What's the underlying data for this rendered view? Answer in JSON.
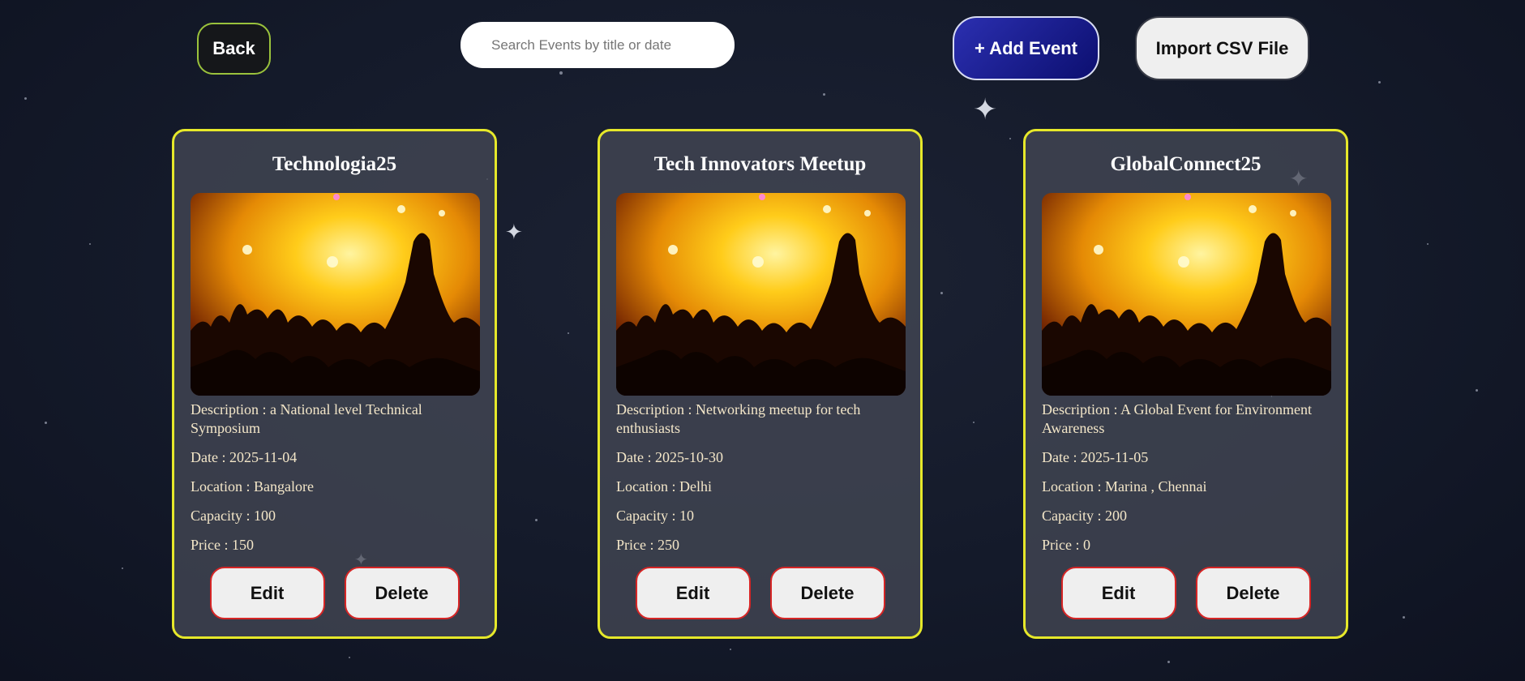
{
  "toolbar": {
    "back_label": "Back",
    "search_placeholder": "Search Events by title or date",
    "search_value": "",
    "add_label": "+ Add Event",
    "import_label": "Import CSV File"
  },
  "field_labels": {
    "description": "Description : ",
    "date": "Date : ",
    "location": "Location : ",
    "capacity": "Capacity : ",
    "price": "Price : "
  },
  "card_actions": {
    "edit_label": "Edit",
    "delete_label": "Delete"
  },
  "events": [
    {
      "title": "Technologia25",
      "image": "concert-crowd-photo",
      "description": "a National level Technical Symposium",
      "date": "2025-11-04",
      "location": "Bangalore",
      "capacity": "100",
      "price": "150"
    },
    {
      "title": "Tech Innovators Meetup",
      "image": "concert-crowd-photo",
      "description": "Networking meetup for tech enthusiasts",
      "date": "2025-10-30",
      "location": "Delhi",
      "capacity": "10",
      "price": "250"
    },
    {
      "title": "GlobalConnect25",
      "image": "concert-crowd-photo",
      "description": "A Global Event for Environment Awareness",
      "date": "2025-11-05",
      "location": "Marina , Chennai",
      "capacity": "200",
      "price": "0"
    }
  ],
  "colors": {
    "card_border": "#e6e82a",
    "action_border": "#d62525",
    "add_button": "#1a1d8f",
    "back_border": "#9ac23c",
    "field_text": "#f3e6c8"
  }
}
